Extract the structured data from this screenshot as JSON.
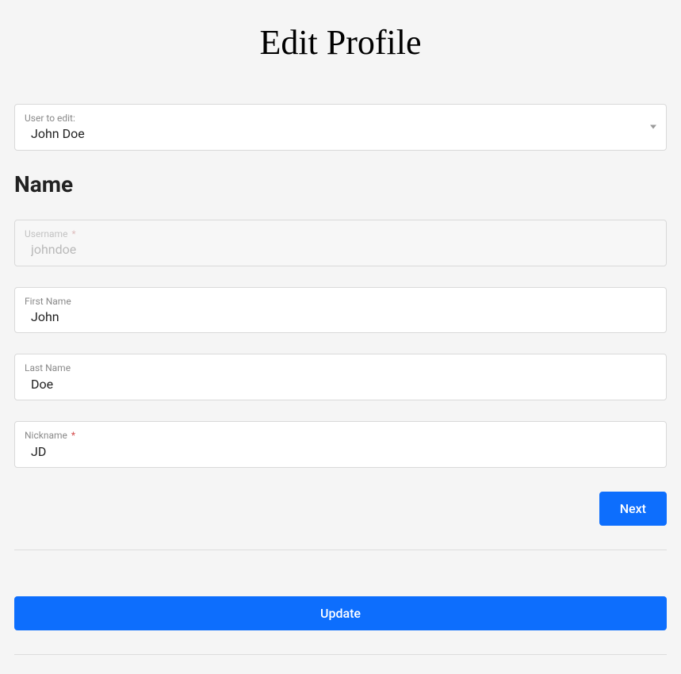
{
  "page": {
    "title": "Edit Profile"
  },
  "user_select": {
    "label": "User to edit:",
    "selected": "John Doe"
  },
  "section": {
    "name_heading": "Name"
  },
  "fields": {
    "username": {
      "label": "Username",
      "required_mark": "*",
      "value": "johndoe"
    },
    "first_name": {
      "label": "First Name",
      "value": "John"
    },
    "last_name": {
      "label": "Last Name",
      "value": "Doe"
    },
    "nickname": {
      "label": "Nickname",
      "required_mark": "*",
      "value": "JD"
    }
  },
  "buttons": {
    "next": "Next",
    "update": "Update"
  }
}
